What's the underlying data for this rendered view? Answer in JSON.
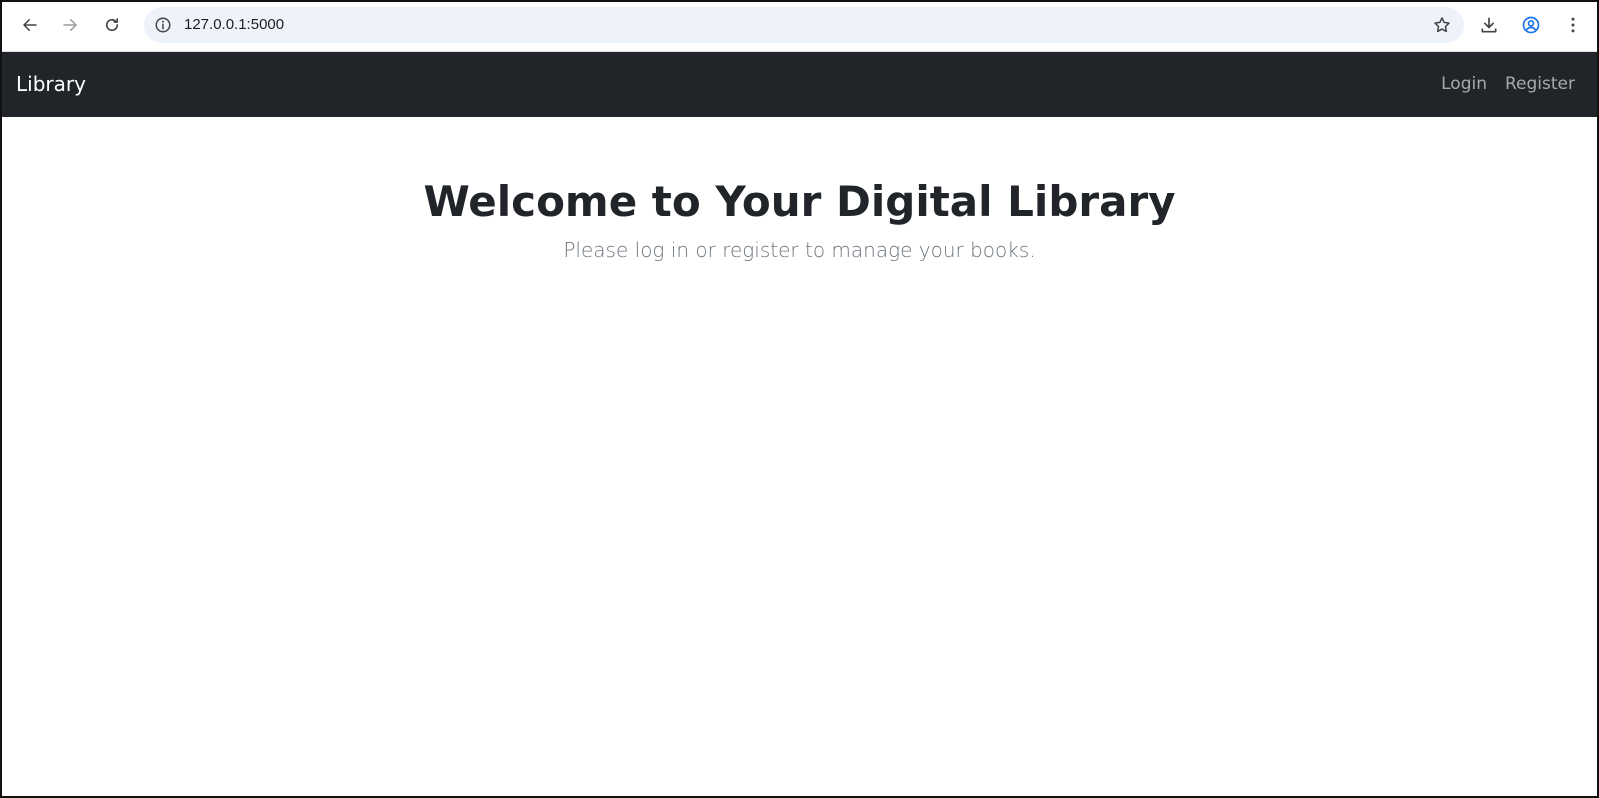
{
  "browser": {
    "url": "127.0.0.1:5000",
    "icons": {
      "back": "arrow-left-icon",
      "forward": "arrow-right-icon",
      "reload": "reload-icon",
      "info": "info-icon",
      "bookmark": "star-icon",
      "download": "download-icon",
      "profile": "profile-icon",
      "menu": "more-vertical-icon"
    },
    "accent_color": "#1a73e8"
  },
  "navbar": {
    "brand": "Library",
    "links": [
      {
        "label": "Login"
      },
      {
        "label": "Register"
      }
    ],
    "background": "#212529"
  },
  "main": {
    "title": "Welcome to Your Digital Library",
    "lead": "Please log in or register to manage your books."
  }
}
